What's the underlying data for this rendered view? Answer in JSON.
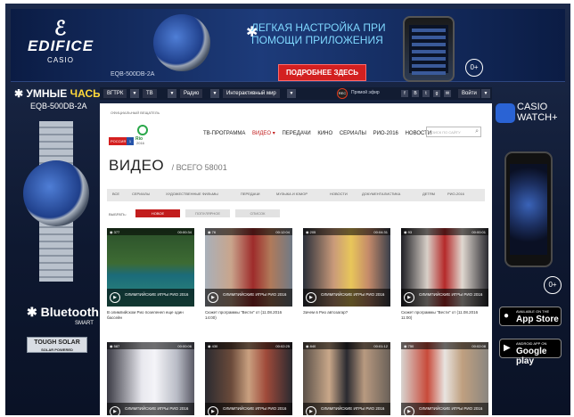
{
  "colors": {
    "accent": "#c21d1d",
    "bg_dark": "#0e1830",
    "cta_red": "#d32020"
  },
  "banner": {
    "logo_mark": "ℰ",
    "logo_name": "EDIFICE",
    "logo_brand": "CASIO",
    "model": "EQB-500DB-2A",
    "headline_line1": "ЛЕГКАЯ НАСТРОЙКА ПРИ",
    "headline_line2": "ПОМОЩИ ПРИЛОЖЕНИЯ",
    "cta": "ПОДРОБНЕЕ ЗДЕСЬ",
    "age": "0+"
  },
  "left_ad": {
    "title_plain": "УМНЫЕ",
    "title_accent": "ЧАСЫ.",
    "model": "EQB-500DB-2A",
    "bluetooth": "Bluetooth",
    "bluetooth_sub": "SMART",
    "tough": "TOUGH SOLAR",
    "tough_sub": "SOLAR POWERED"
  },
  "right_ad": {
    "title_line1": "CASIO",
    "title_line2": "WATCH+",
    "age": "0+",
    "appstore_small": "Available on the",
    "appstore_big": "App Store",
    "google_small": "ANDROID APP ON",
    "google_big": "Google play"
  },
  "topnav": {
    "items": [
      "ВГТРК",
      "ТВ",
      "Радио",
      "Интерактивный мир"
    ],
    "rec_label": "REC",
    "live_label": "Прямой эфир",
    "social": [
      "f",
      "В",
      "t",
      "g",
      "✉"
    ],
    "login": "Войти"
  },
  "main": {
    "founder": "ОФИЦИАЛЬНЫЙ ВЕЩАТЕЛЬ",
    "rossiya": "РОССИЯ",
    "rossiya_num": "1",
    "rio_text": "Rio",
    "rio_year": "2016",
    "nav": [
      "ТВ-ПРОГРАММА",
      "ВИДЕО ▾",
      "ПЕРЕДАЧИ",
      "КИНО",
      "СЕРИАЛЫ",
      "РИО-2016",
      "НОВОСТИ"
    ],
    "search_placeholder": "ПОИСК ПО САЙТУ",
    "title": "ВИДЕО",
    "count": "/ ВСЕГО 58001",
    "categories": [
      "ВСЕ",
      "СЕРИАЛЫ",
      "ХУДОЖЕСТВЕННЫЕ ФИЛЬМЫ",
      "ПЕРЕДАЧИ",
      "МУЗЫКА И ЮМОР",
      "НОВОСТИ",
      "ДОКУМЕНТАЛИСТИКА",
      "ДЕТЯМ",
      "РИО-2016"
    ],
    "sort_label": "ВЫБРАТЬ:",
    "sort": [
      "НОВОЕ",
      "ПОПУЛЯРНОЕ",
      "СПИСОК"
    ],
    "videos": [
      {
        "views": "377",
        "duration": "00:00:34",
        "caption": "ОЛИМПИЙСКИЕ ИГРЫ РИО 2016",
        "desc": "В олимпийском Рио позеленел еще один бассейн"
      },
      {
        "views": "76",
        "duration": "00:12:04",
        "caption": "ОЛИМПИЙСКИЕ ИГРЫ РИО 2016",
        "desc": "Сюжет программы \"Вести\" от (11.08.2016 14:00)"
      },
      {
        "views": "205",
        "duration": "00:04:31",
        "caption": "ОЛИМПИЙСКИЕ ИГРЫ РИО 2016",
        "desc": "Зачем в Рио автозагар?"
      },
      {
        "views": "93",
        "duration": "00:00:01",
        "caption": "ОЛИМПИЙСКИЕ ИГРЫ РИО 2016",
        "desc": "Сюжет программы \"Вести\" от (11.08.2016 11:00)"
      },
      {
        "views": "587",
        "duration": "00:00:06",
        "caption": "ОЛИМПИЙСКИЕ ИГРЫ РИО 2016",
        "desc": ""
      },
      {
        "views": "430",
        "duration": "00:02:25",
        "caption": "ОЛИМПИЙСКИЕ ИГРЫ РИО 2016",
        "desc": ""
      },
      {
        "views": "840",
        "duration": "00:01:12",
        "caption": "ОЛИМПИЙСКИЕ ИГРЫ РИО 2016",
        "desc": ""
      },
      {
        "views": "750",
        "duration": "00:02:08",
        "caption": "ОЛИМПИЙСКИЕ ИГРЫ РИО 2016",
        "desc": ""
      }
    ]
  }
}
